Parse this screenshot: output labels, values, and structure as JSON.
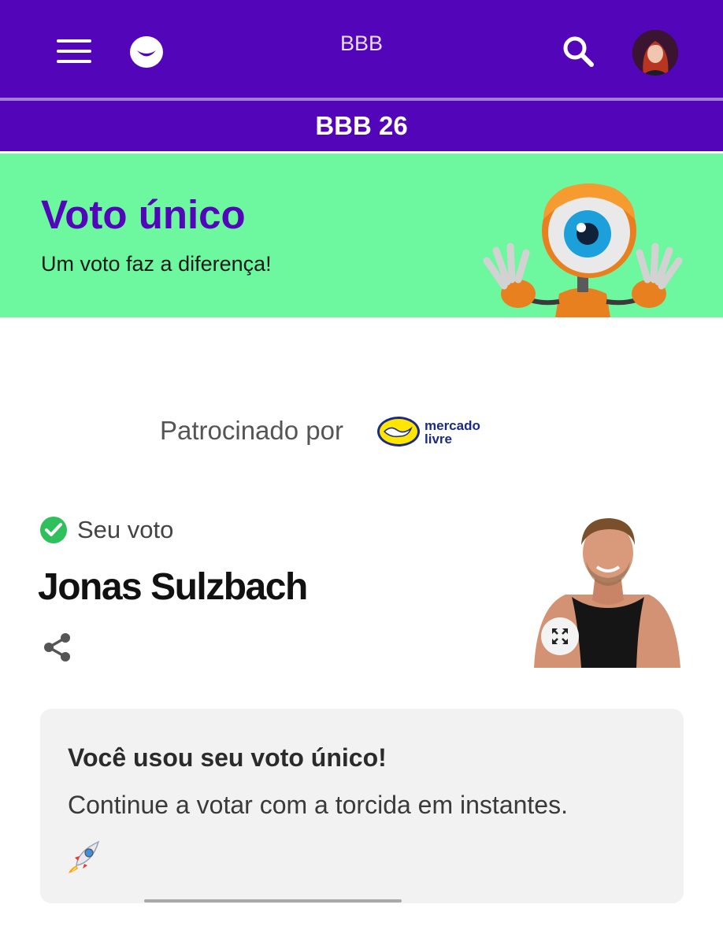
{
  "header": {
    "title": "BBB",
    "section": "BBB 26"
  },
  "banner": {
    "title": "Voto único",
    "subtitle": "Um voto faz a diferença!"
  },
  "sponsor": {
    "label": "Patrocinado por",
    "brand_line1": "mercado",
    "brand_line2": "livre"
  },
  "vote": {
    "label": "Seu voto",
    "candidate": "Jonas Sulzbach"
  },
  "info": {
    "title": "Você usou seu voto único!",
    "text": "Continue a votar com a torcida em instantes."
  },
  "icons": [
    "menu-icon",
    "globo-logo-icon",
    "search-icon",
    "check-circle-icon",
    "share-icon",
    "expand-icon",
    "rocket-icon"
  ],
  "colors": {
    "brand_purple": "#5305ba",
    "banner_green": "#6df79e",
    "check_green": "#2ec05b",
    "card_gray": "#f2f2f2"
  }
}
